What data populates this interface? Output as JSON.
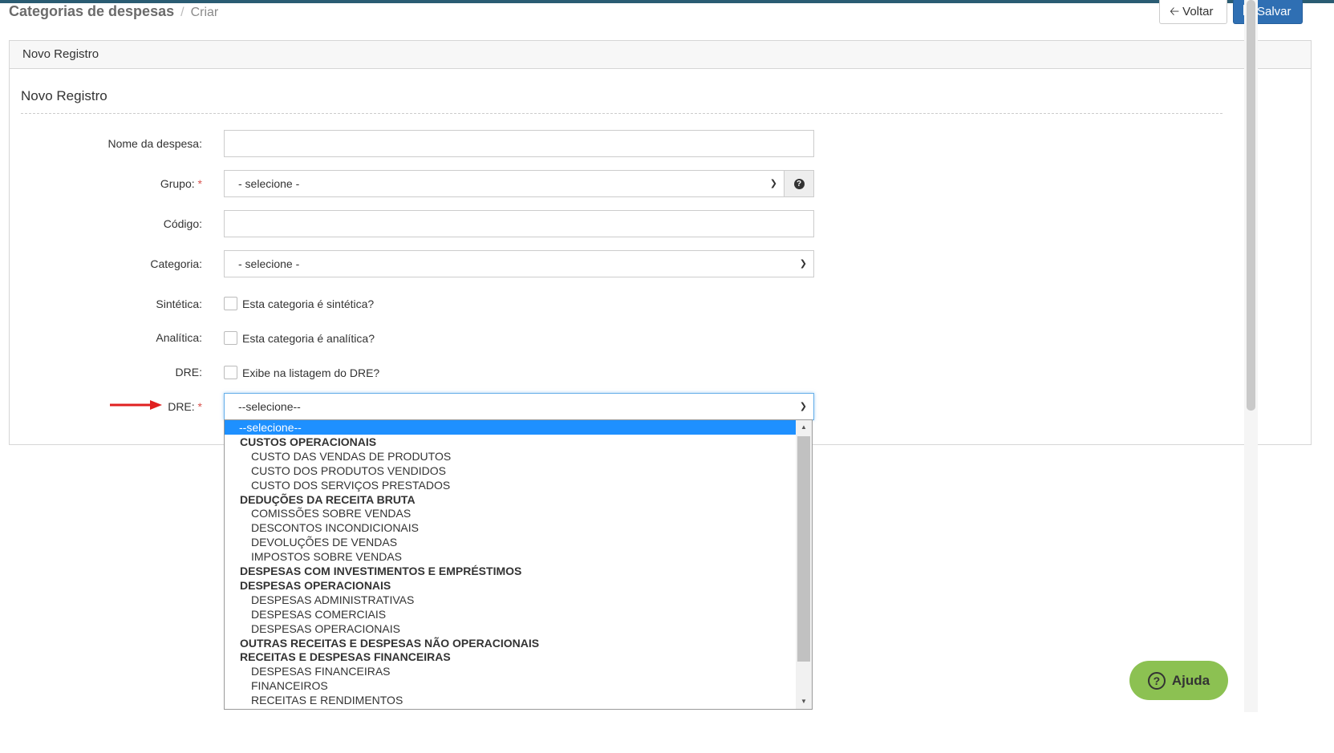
{
  "breadcrumb": {
    "title": "Categorias de despesas",
    "separator": "/",
    "current": "Criar"
  },
  "toolbar": {
    "back_label": "Voltar",
    "save_label": "Salvar"
  },
  "panel": {
    "heading": "Novo Registro",
    "section_title": "Novo Registro"
  },
  "form": {
    "nome_label": "Nome da despesa:",
    "grupo_label": "Grupo:",
    "grupo_value": "- selecione -",
    "codigo_label": "Código:",
    "categoria_label": "Categoria:",
    "categoria_value": "- selecione -",
    "sintetica_label": "Sintética:",
    "sintetica_text": "Esta categoria é sintética?",
    "analitica_label": "Analítica:",
    "analitica_text": "Esta categoria é analítica?",
    "dre_check_label": "DRE:",
    "dre_check_text": "Exibe na listagem do DRE?",
    "dre_select_label": "DRE:",
    "dre_select_value": "--selecione--",
    "required_mark": "*"
  },
  "dre_options": [
    {
      "label": "--selecione--",
      "kind": "selected"
    },
    {
      "label": "CUSTOS OPERACIONAIS",
      "kind": "group"
    },
    {
      "label": "CUSTO DAS VENDAS DE PRODUTOS",
      "kind": "child"
    },
    {
      "label": "CUSTO DOS PRODUTOS VENDIDOS",
      "kind": "child"
    },
    {
      "label": "CUSTO DOS SERVIÇOS PRESTADOS",
      "kind": "child"
    },
    {
      "label": "DEDUÇÕES DA RECEITA BRUTA",
      "kind": "group"
    },
    {
      "label": "COMISSÕES SOBRE VENDAS",
      "kind": "child"
    },
    {
      "label": "DESCONTOS INCONDICIONAIS",
      "kind": "child"
    },
    {
      "label": "DEVOLUÇÕES DE VENDAS",
      "kind": "child"
    },
    {
      "label": "IMPOSTOS SOBRE VENDAS",
      "kind": "child"
    },
    {
      "label": "DESPESAS COM INVESTIMENTOS E EMPRÉSTIMOS",
      "kind": "group"
    },
    {
      "label": "DESPESAS OPERACIONAIS",
      "kind": "group"
    },
    {
      "label": "DESPESAS ADMINISTRATIVAS",
      "kind": "child"
    },
    {
      "label": "DESPESAS COMERCIAIS",
      "kind": "child"
    },
    {
      "label": "DESPESAS OPERACIONAIS",
      "kind": "child"
    },
    {
      "label": "OUTRAS RECEITAS E DESPESAS NÃO OPERACIONAIS",
      "kind": "group"
    },
    {
      "label": "RECEITAS E DESPESAS FINANCEIRAS",
      "kind": "group"
    },
    {
      "label": "DESPESAS FINANCEIRAS",
      "kind": "child"
    },
    {
      "label": "FINANCEIROS",
      "kind": "child"
    },
    {
      "label": "RECEITAS E RENDIMENTOS",
      "kind": "child"
    }
  ],
  "help_widget": {
    "label": "Ajuda"
  },
  "colors": {
    "accent": "#2f6fb3",
    "selected_option": "#1e90ff",
    "required": "#d9534f",
    "help": "#8cc152",
    "arrow": "#e02020"
  }
}
